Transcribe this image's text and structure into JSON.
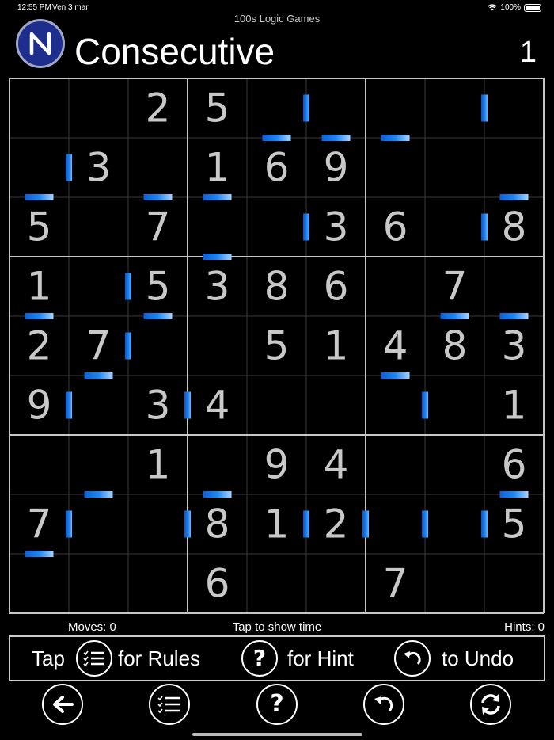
{
  "status_bar": {
    "time": "12:55 PM",
    "date": "Ven 3 mar",
    "battery": "100%"
  },
  "app": {
    "name": "100s Logic Games"
  },
  "header": {
    "title": "Consecutive",
    "puzzle_number": "1"
  },
  "grid": {
    "cells": [
      [
        "",
        "",
        "2",
        "5",
        "",
        "",
        "",
        "",
        ""
      ],
      [
        "",
        "3",
        "",
        "1",
        "6",
        "9",
        "",
        "",
        ""
      ],
      [
        "5",
        "",
        "7",
        "",
        "",
        "3",
        "6",
        "",
        "8"
      ],
      [
        "1",
        "",
        "5",
        "3",
        "8",
        "6",
        "",
        "7",
        ""
      ],
      [
        "2",
        "7",
        "",
        "",
        "5",
        "1",
        "4",
        "8",
        "3"
      ],
      [
        "9",
        "",
        "3",
        "4",
        "",
        "",
        "",
        "",
        "1"
      ],
      [
        "",
        "",
        "1",
        "",
        "9",
        "4",
        "",
        "",
        "6"
      ],
      [
        "7",
        "",
        "",
        "8",
        "1",
        "2",
        "",
        "",
        "5"
      ],
      [
        "",
        "",
        "",
        "6",
        "",
        "",
        "7",
        "",
        ""
      ]
    ],
    "vertical_bars": [
      [
        0,
        4
      ],
      [
        0,
        7
      ],
      [
        1,
        0
      ],
      [
        2,
        4
      ],
      [
        2,
        7
      ],
      [
        3,
        1
      ],
      [
        4,
        1
      ],
      [
        5,
        0
      ],
      [
        5,
        2
      ],
      [
        5,
        6
      ],
      [
        7,
        0
      ],
      [
        7,
        2
      ],
      [
        7,
        4
      ],
      [
        7,
        5
      ],
      [
        7,
        6
      ],
      [
        7,
        7
      ]
    ],
    "horizontal_bars": [
      [
        0,
        4
      ],
      [
        0,
        5
      ],
      [
        0,
        6
      ],
      [
        1,
        0
      ],
      [
        1,
        2
      ],
      [
        1,
        3
      ],
      [
        1,
        8
      ],
      [
        2,
        3
      ],
      [
        3,
        0
      ],
      [
        3,
        2
      ],
      [
        3,
        7
      ],
      [
        3,
        8
      ],
      [
        4,
        1
      ],
      [
        4,
        6
      ],
      [
        6,
        1
      ],
      [
        6,
        3
      ],
      [
        6,
        8
      ],
      [
        7,
        0
      ]
    ],
    "colors": {
      "digit": "#c8c8c8",
      "bar": "#1f86f0",
      "thin_line": "#3a3a3a",
      "thick_line": "#c6c6c6"
    }
  },
  "info": {
    "moves": "Moves: 0",
    "time": "Tap to show time",
    "hints": "Hints: 0"
  },
  "help": {
    "tap": "Tap",
    "rules": "for Rules",
    "hint": "for Hint",
    "undo": "to Undo"
  },
  "icons": {
    "logo": "n-logo-icon",
    "rules": "list-check-icon",
    "hint": "question-icon",
    "undo": "undo-icon",
    "back": "arrow-left-icon",
    "refresh": "refresh-icon"
  }
}
